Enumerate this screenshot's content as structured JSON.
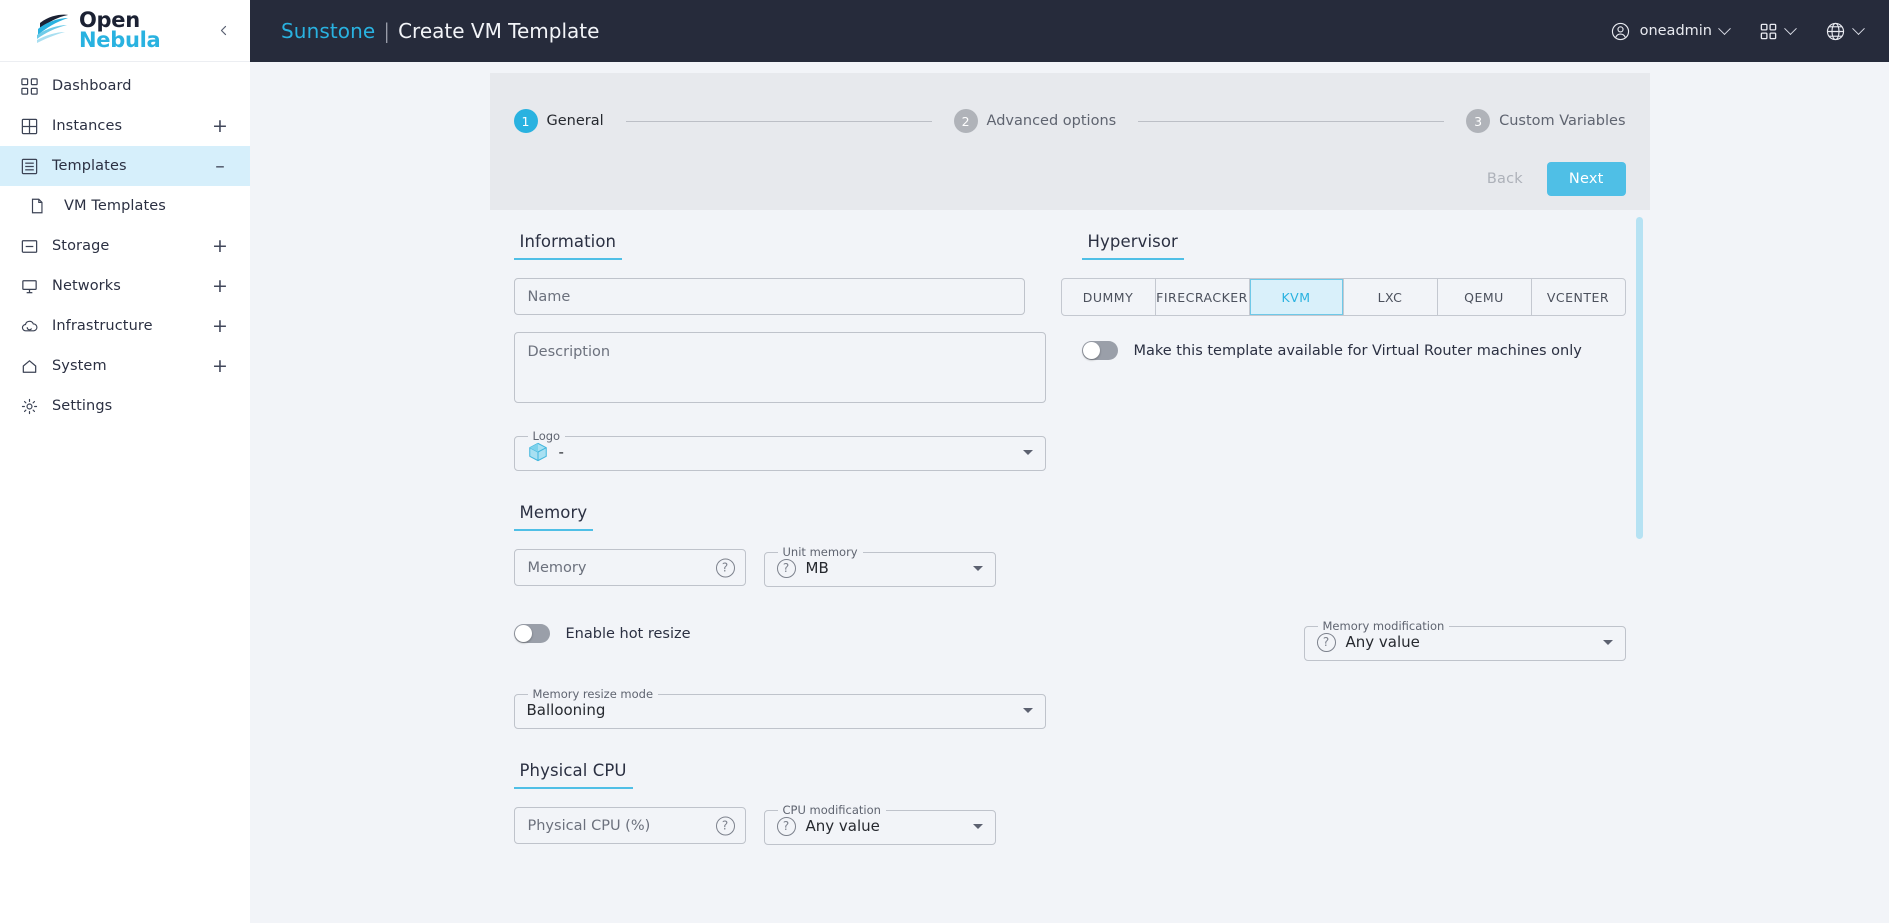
{
  "brand": {
    "line1": "Open",
    "line2": "Nebula",
    "collapse_icon": "chevron-left-icon"
  },
  "sidebar": {
    "items": [
      {
        "label": "Dashboard",
        "icon": "dashboard-icon",
        "expand": "",
        "active": false
      },
      {
        "label": "Instances",
        "icon": "grid-icon",
        "expand": "+",
        "active": false
      },
      {
        "label": "Templates",
        "icon": "templates-icon",
        "expand": "–",
        "active": true
      },
      {
        "label": "Storage",
        "icon": "storage-icon",
        "expand": "+",
        "active": false
      },
      {
        "label": "Networks",
        "icon": "network-icon",
        "expand": "+",
        "active": false
      },
      {
        "label": "Infrastructure",
        "icon": "cloud-icon",
        "expand": "+",
        "active": false
      },
      {
        "label": "System",
        "icon": "home-icon",
        "expand": "+",
        "active": false
      },
      {
        "label": "Settings",
        "icon": "gear-icon",
        "expand": "",
        "active": false
      }
    ],
    "subitem": {
      "label": "VM Templates",
      "icon": "file-icon"
    }
  },
  "header": {
    "app_name": "Sunstone",
    "separator": "|",
    "page_title": "Create VM Template",
    "user": "oneadmin",
    "user_icon": "account-circle-icon",
    "apps_icon": "apps-grid-icon",
    "language_icon": "globe-icon"
  },
  "stepper": {
    "steps": [
      {
        "number": "1",
        "label": "General",
        "active": true
      },
      {
        "number": "2",
        "label": "Advanced options",
        "active": false
      },
      {
        "number": "3",
        "label": "Custom Variables",
        "active": false
      }
    ],
    "back_label": "Back",
    "next_label": "Next"
  },
  "information": {
    "section_title": "Information",
    "name_placeholder": "Name",
    "name_value": "",
    "description_placeholder": "Description",
    "description_value": "",
    "logo_legend": "Logo",
    "logo_value": "-",
    "logo_icon": "cube-icon"
  },
  "hypervisor": {
    "section_title": "Hypervisor",
    "options": [
      "DUMMY",
      "FIRECRACKER",
      "KVM",
      "LXC",
      "QEMU",
      "VCENTER"
    ],
    "selected": "KVM",
    "vrouter_toggle_label": "Make this template available for Virtual Router machines only",
    "vrouter_toggle_on": false
  },
  "memory": {
    "section_title": "Memory",
    "memory_placeholder": "Memory",
    "memory_value": "",
    "memory_help_icon": "help-circle-icon",
    "unit_legend": "Unit memory",
    "unit_value": "MB",
    "unit_help_icon": "help-circle-icon",
    "hot_resize_label": "Enable hot resize",
    "hot_resize_on": false,
    "modification_legend": "Memory modification",
    "modification_value": "Any value",
    "modification_help_icon": "help-circle-icon",
    "resize_mode_legend": "Memory resize mode",
    "resize_mode_value": "Ballooning"
  },
  "physical_cpu": {
    "section_title": "Physical CPU",
    "cpu_placeholder": "Physical CPU (%)",
    "cpu_value": "",
    "cpu_help_icon": "help-circle-icon",
    "modification_legend": "CPU modification",
    "modification_value": "Any value",
    "modification_help_icon": "help-circle-icon"
  },
  "colors": {
    "accent": "#29b2e0",
    "next_button": "#4fbfe6",
    "topbar": "#262b3b",
    "page_background": "#f2f4f8",
    "stepper_panel": "#e7e9ed",
    "sidebar_active": "#d6effb",
    "scrollbar": "#b6e2f3"
  }
}
